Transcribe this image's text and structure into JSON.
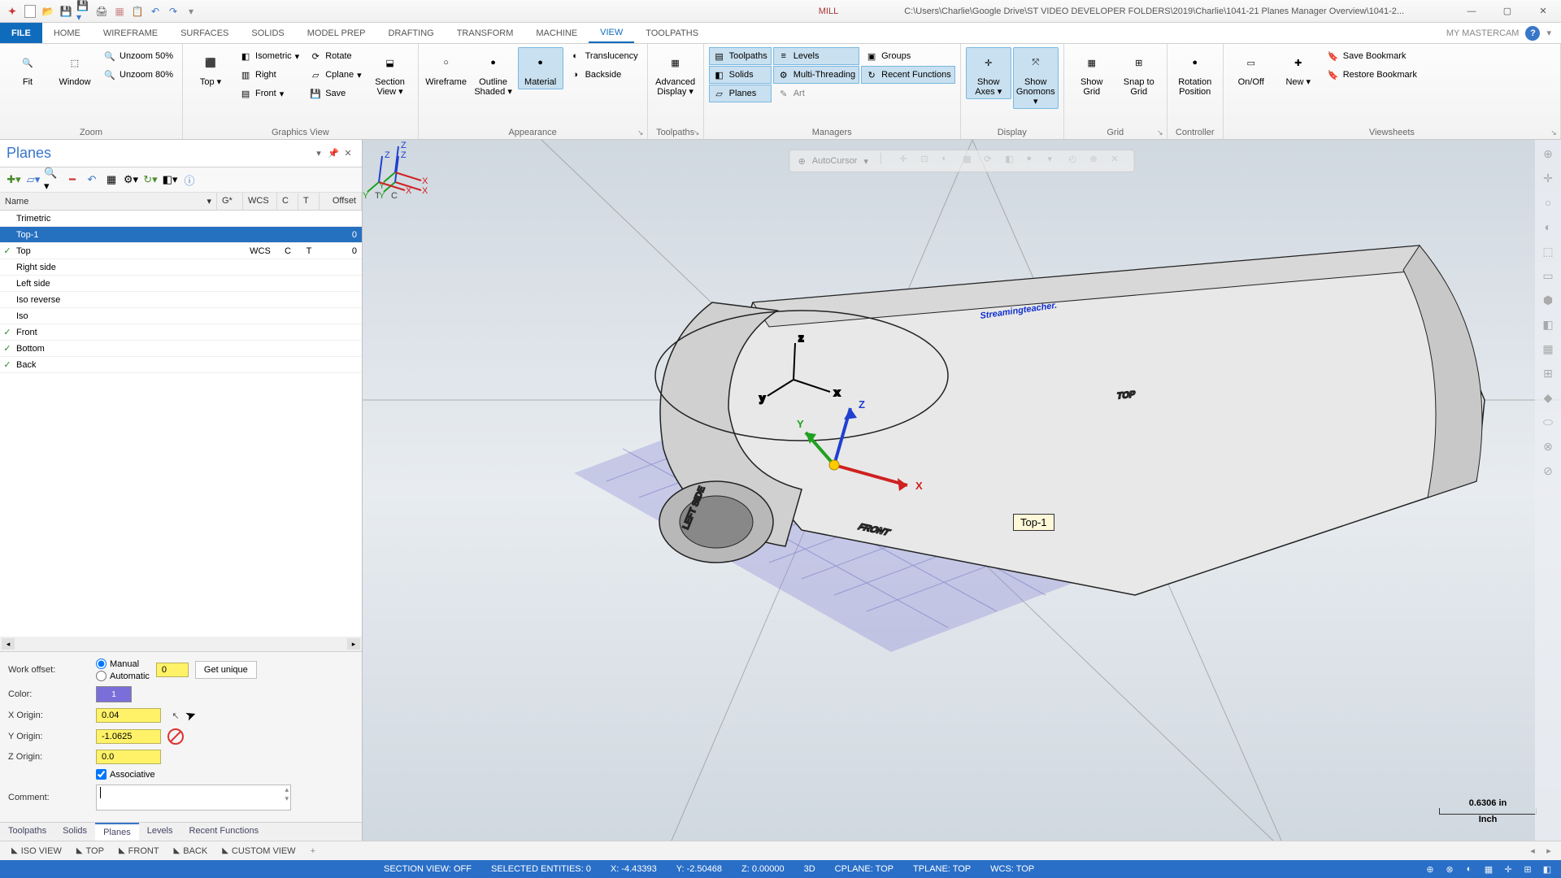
{
  "title": {
    "context_tab": "MILL",
    "path": "C:\\Users\\Charlie\\Google Drive\\ST VIDEO DEVELOPER FOLDERS\\2019\\Charlie\\1041-21 Planes Manager Overview\\1041-2..."
  },
  "ribbon_tabs": [
    "FILE",
    "HOME",
    "WIREFRAME",
    "SURFACES",
    "SOLIDS",
    "MODEL PREP",
    "DRAFTING",
    "TRANSFORM",
    "MACHINE",
    "VIEW",
    "TOOLPATHS"
  ],
  "ribbon_active": "VIEW",
  "mymastercam": "MY MASTERCAM",
  "ribbon": {
    "zoom": {
      "fit": "Fit",
      "window": "Window",
      "unzoom50": "Unzoom 50%",
      "unzoom80": "Unzoom 80%",
      "label": "Zoom"
    },
    "gv": {
      "top": "Top",
      "iso": "Isometric",
      "right": "Right",
      "front": "Front",
      "rotate": "Rotate",
      "cplane": "Cplane",
      "save": "Save",
      "section": "Section View",
      "label": "Graphics View"
    },
    "appearance": {
      "wireframe": "Wireframe",
      "outline": "Outline Shaded",
      "material": "Material",
      "translucency": "Translucency",
      "backside": "Backside",
      "label": "Appearance"
    },
    "toolpaths": {
      "advdisp": "Advanced Display",
      "label": "Toolpaths"
    },
    "managers": {
      "toolpaths": "Toolpaths",
      "solids": "Solids",
      "planes": "Planes",
      "levels": "Levels",
      "multithreading": "Multi-Threading",
      "art": "Art",
      "groups": "Groups",
      "recent": "Recent Functions",
      "label": "Managers"
    },
    "display": {
      "axes": "Show Axes",
      "gnomons": "Show Gnomons",
      "label": "Display"
    },
    "grid": {
      "show": "Show Grid",
      "snap": "Snap to Grid",
      "label": "Grid"
    },
    "controller": {
      "rotpos": "Rotation Position",
      "label": "Controller"
    },
    "viewsheets": {
      "onoff": "On/Off",
      "new": "New",
      "savebm": "Save Bookmark",
      "restorebm": "Restore Bookmark",
      "label": "Viewsheets"
    }
  },
  "panel": {
    "title": "Planes",
    "columns": {
      "name": "Name",
      "g": "G*",
      "wcs": "WCS",
      "c": "C",
      "t": "T",
      "offset": "Offset"
    },
    "rows": [
      {
        "check": false,
        "name": "Trimetric",
        "g": "",
        "wcs": "",
        "c": "",
        "t": "",
        "off": "",
        "sel": false
      },
      {
        "check": false,
        "name": "Top-1",
        "g": "",
        "wcs": "",
        "c": "",
        "t": "",
        "off": "0",
        "sel": true
      },
      {
        "check": true,
        "name": "Top",
        "g": "",
        "wcs": "WCS",
        "c": "C",
        "t": "T",
        "off": "0",
        "sel": false
      },
      {
        "check": false,
        "name": "Right side",
        "g": "",
        "wcs": "",
        "c": "",
        "t": "",
        "off": "",
        "sel": false
      },
      {
        "check": false,
        "name": "Left side",
        "g": "",
        "wcs": "",
        "c": "",
        "t": "",
        "off": "",
        "sel": false
      },
      {
        "check": false,
        "name": "Iso reverse",
        "g": "",
        "wcs": "",
        "c": "",
        "t": "",
        "off": "",
        "sel": false
      },
      {
        "check": false,
        "name": "Iso",
        "g": "",
        "wcs": "",
        "c": "",
        "t": "",
        "off": "",
        "sel": false
      },
      {
        "check": true,
        "name": "Front",
        "g": "",
        "wcs": "",
        "c": "",
        "t": "",
        "off": "",
        "sel": false
      },
      {
        "check": true,
        "name": "Bottom",
        "g": "",
        "wcs": "",
        "c": "",
        "t": "",
        "off": "",
        "sel": false
      },
      {
        "check": true,
        "name": "Back",
        "g": "",
        "wcs": "",
        "c": "",
        "t": "",
        "off": "",
        "sel": false
      }
    ],
    "form": {
      "workoffset_lbl": "Work offset:",
      "manual": "Manual",
      "automatic": "Automatic",
      "workoffset_val": "0",
      "getunique": "Get unique",
      "color_lbl": "Color:",
      "color_val": "1",
      "xorigin_lbl": "X Origin:",
      "xorigin": "0.04",
      "yorigin_lbl": "Y Origin:",
      "yorigin": "-1.0625",
      "zorigin_lbl": "Z Origin:",
      "zorigin": "0.0",
      "associative": "Associative",
      "comment_lbl": "Comment:"
    },
    "tabs": [
      "Toolpaths",
      "Solids",
      "Planes",
      "Levels",
      "Recent Functions"
    ],
    "active_tab": "Planes"
  },
  "viewport": {
    "autocursor": "AutoCursor",
    "plane_label": "Top-1",
    "text_top": "TOP",
    "text_front": "FRONT",
    "text_left": "LEFT SIDE",
    "text_brand": "Streamingteacher.",
    "scale_val": "0.6306 in",
    "scale_unit": "Inch",
    "axis_cx": "X",
    "axis_cy": "Y",
    "axis_cz": "Z"
  },
  "viewtabs": [
    "ISO VIEW",
    "TOP",
    "FRONT",
    "BACK",
    "CUSTOM VIEW"
  ],
  "status": {
    "section": "SECTION VIEW: OFF",
    "selected": "SELECTED ENTITIES: 0",
    "x": "X: -4.43393",
    "y": "Y: -2.50468",
    "z": "Z: 0.00000",
    "mode": "3D",
    "cplane": "CPLANE: TOP",
    "tplane": "TPLANE: TOP",
    "wcs": "WCS: TOP"
  }
}
